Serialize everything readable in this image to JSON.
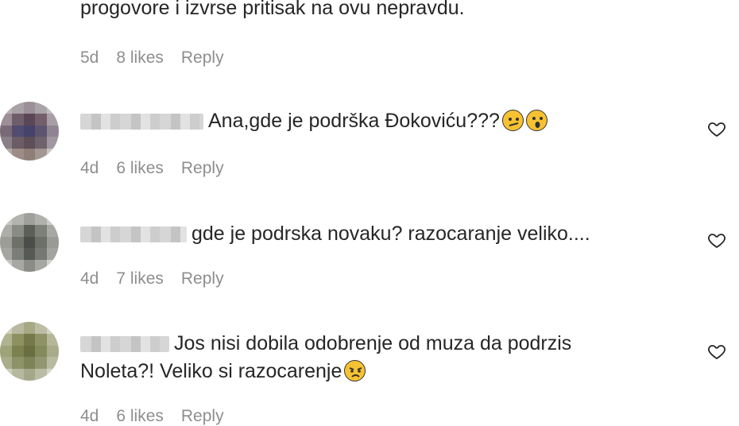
{
  "comments": [
    {
      "text": "progovore i izvrse pritisak na ovu nepravdu.",
      "age": "5d",
      "likes": "8 likes",
      "reply": "Reply"
    },
    {
      "text": "Ana,gde je podrška Đokoviću???",
      "emojis": [
        "confused-face",
        "astonished-face"
      ],
      "age": "4d",
      "likes": "6 likes",
      "reply": "Reply"
    },
    {
      "text": "gde je podrska novaku? razocaranje veliko....",
      "age": "4d",
      "likes": "7 likes",
      "reply": "Reply"
    },
    {
      "text_line1": "Jos nisi dobila odobrenje od muza da podrzis",
      "text_line2": "Noleta?! Veliko si razocarenje",
      "emojis": [
        "angry-face"
      ],
      "age": "4d",
      "likes": "6 likes",
      "reply": "Reply"
    }
  ],
  "icons": {
    "like": "heart-outline-icon"
  },
  "colors": {
    "text": "#262626",
    "meta": "#8e8e8e",
    "emoji": "#f7c232"
  }
}
